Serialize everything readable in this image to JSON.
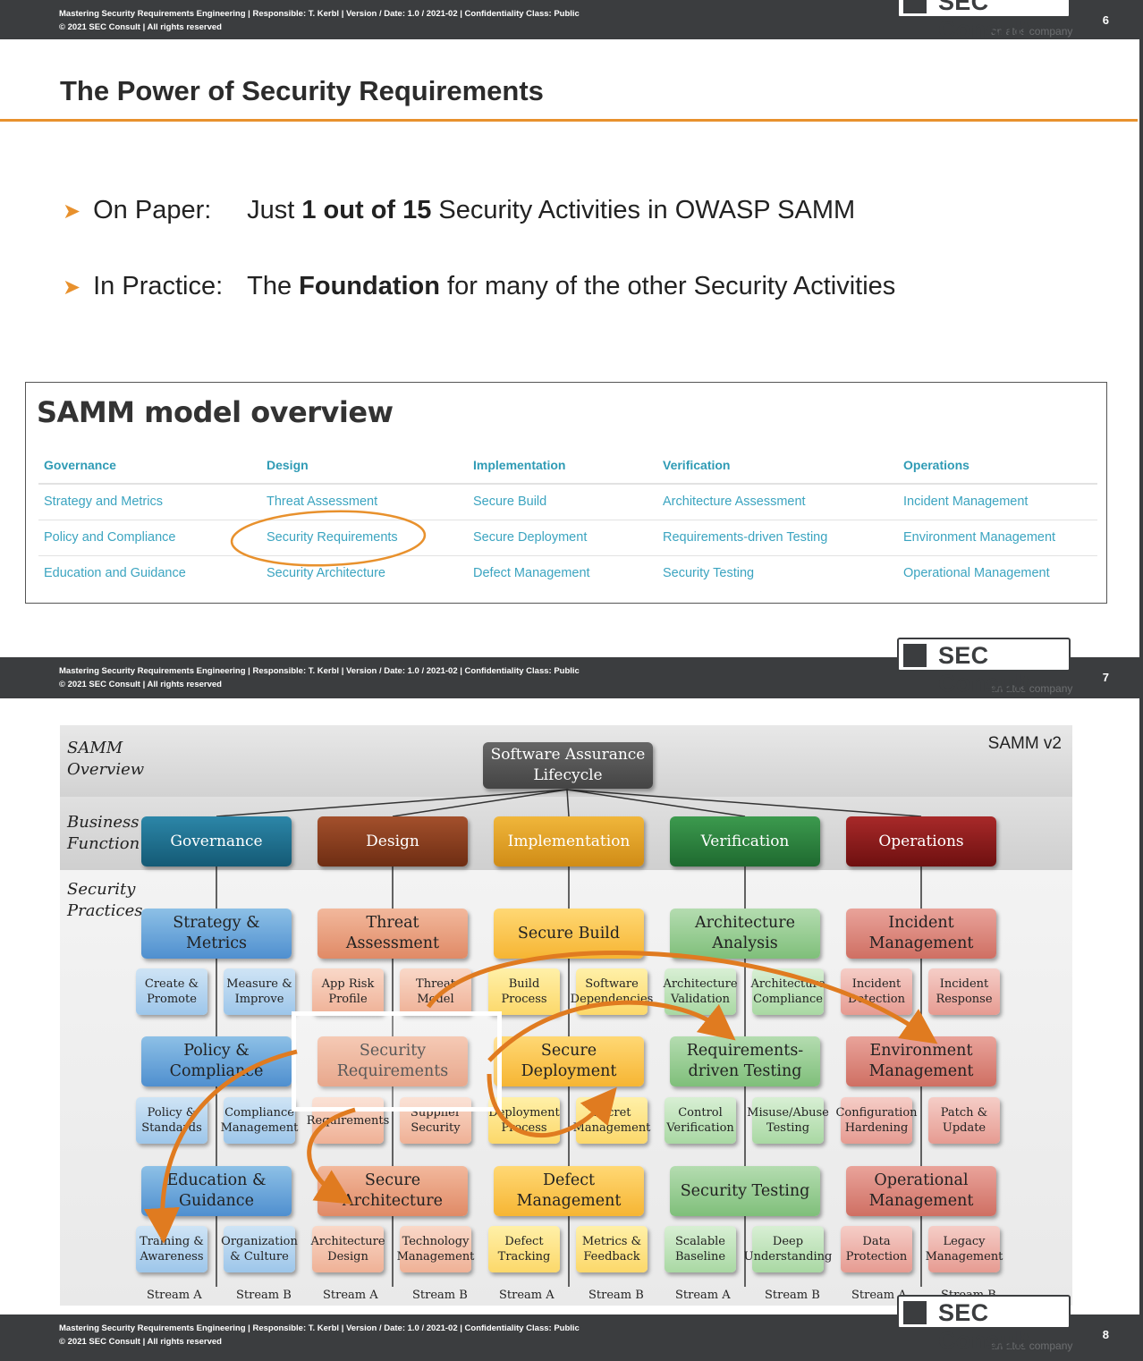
{
  "footer": {
    "line1": "Mastering Security Requirements Engineering | Responsible: T. Kerbl | Version / Date: 1.0 / 2021-02 | Confidentiality Class: Public",
    "line2": "© 2021 SEC Consult | All rights reserved",
    "brand": "SEC Consult",
    "brand_sub": "an atos company",
    "pages": [
      "6",
      "7",
      "8"
    ]
  },
  "slide7": {
    "title": "The Power of Security Requirements",
    "bullets": [
      {
        "label": "On Paper:",
        "pre": "Just ",
        "bold": "1 out of 15",
        "post": " Security Activities in OWASP SAMM"
      },
      {
        "label": "In Practice:",
        "pre": "The ",
        "bold": "Foundation",
        "post": " for many of the other Security Activities"
      }
    ],
    "samm_table": {
      "title": "SAMM model overview",
      "headers": [
        "Governance",
        "Design",
        "Implementation",
        "Verification",
        "Operations"
      ],
      "rows": [
        [
          "Strategy and Metrics",
          "Threat Assessment",
          "Secure Build",
          "Architecture Assessment",
          "Incident Management"
        ],
        [
          "Policy and Compliance",
          "Security Requirements",
          "Secure Deployment",
          "Requirements-driven Testing",
          "Environment Management"
        ],
        [
          "Education and Guidance",
          "Security Architecture",
          "Defect Management",
          "Security Testing",
          "Operational Management"
        ]
      ]
    }
  },
  "slide8": {
    "corner_title": "SAMM v2",
    "row_labels": [
      "SAMM Overview",
      "Business Function",
      "Security Practices"
    ],
    "top": "Software Assurance Lifecycle",
    "functions": [
      {
        "name": "Governance",
        "color": "#1f6f8b"
      },
      {
        "name": "Design",
        "color": "#8b3a1f"
      },
      {
        "name": "Implementation",
        "color": "#e0a125"
      },
      {
        "name": "Verification",
        "color": "#2e7d3d"
      },
      {
        "name": "Operations",
        "color": "#8b1a1a"
      }
    ],
    "practices": [
      [
        "Strategy & Metrics",
        "Policy & Compliance",
        "Education & Guidance"
      ],
      [
        "Threat Assessment",
        "Security Requirements",
        "Secure Architecture"
      ],
      [
        "Secure Build",
        "Secure Deployment",
        "Defect Management"
      ],
      [
        "Architecture Analysis",
        "Requirements-driven Testing",
        "Security Testing"
      ],
      [
        "Incident Management",
        "Environment Management",
        "Operational Management"
      ]
    ],
    "activities": [
      [
        [
          "Create & Promote",
          "Measure & Improve"
        ],
        [
          "Policy & Standards",
          "Compliance Management"
        ],
        [
          "Training & Awareness",
          "Organization & Culture"
        ]
      ],
      [
        [
          "App Risk Profile",
          "Threat Model"
        ],
        [
          "Requirements",
          "Supplier Security"
        ],
        [
          "Architecture Design",
          "Technology Management"
        ]
      ],
      [
        [
          "Build Process",
          "Software Dependencies"
        ],
        [
          "Deployment Process",
          "Secret Management"
        ],
        [
          "Defect Tracking",
          "Metrics & Feedback"
        ]
      ],
      [
        [
          "Architecture Validation",
          "Architecture Compliance"
        ],
        [
          "Control Verification",
          "Misuse/Abuse Testing"
        ],
        [
          "Scalable Baseline",
          "Deep Understanding"
        ]
      ],
      [
        [
          "Incident Detection",
          "Incident Response"
        ],
        [
          "Configuration Hardening",
          "Patch & Update"
        ],
        [
          "Data Protection",
          "Legacy Management"
        ]
      ]
    ],
    "streams": [
      "Stream A",
      "Stream B"
    ]
  },
  "colors": {
    "orange": "#e8912d",
    "teal": "#3ba4c0",
    "footer": "#3b3d3f"
  }
}
